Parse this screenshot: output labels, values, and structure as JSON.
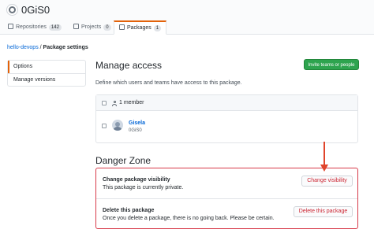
{
  "header": {
    "org_name": "0GiS0",
    "tabs": [
      {
        "label": "Repositories",
        "count": "142",
        "icon": "repo-icon"
      },
      {
        "label": "Projects",
        "count": "0",
        "icon": "project-icon"
      },
      {
        "label": "Packages",
        "count": "1",
        "icon": "package-icon",
        "active": true
      }
    ]
  },
  "breadcrumb": {
    "package": "hello-devops",
    "separator": " / ",
    "page": "Package settings"
  },
  "sidebar": {
    "items": [
      {
        "label": "Options",
        "selected": true
      },
      {
        "label": "Manage versions",
        "selected": false
      }
    ]
  },
  "manage_access": {
    "title": "Manage access",
    "invite_button": "Invite teams or people",
    "description": "Define which users and teams have access to this package.",
    "member_count": "1 member",
    "members": [
      {
        "name": "Gisela",
        "login": "0GiS0"
      }
    ]
  },
  "danger_zone": {
    "title": "Danger Zone",
    "visibility": {
      "title": "Change package visibility",
      "text": "This package is currently private.",
      "button": "Change visibility"
    },
    "delete": {
      "title": "Delete this package",
      "text": "Once you delete a package, there is no going back. Please be certain.",
      "button": "Delete this package"
    }
  },
  "colors": {
    "accent_tab": "#e36209",
    "primary_button": "#2ea44f",
    "danger": "#d73a49",
    "link": "#0366d6",
    "annotation_arrow": "#e0442b"
  }
}
